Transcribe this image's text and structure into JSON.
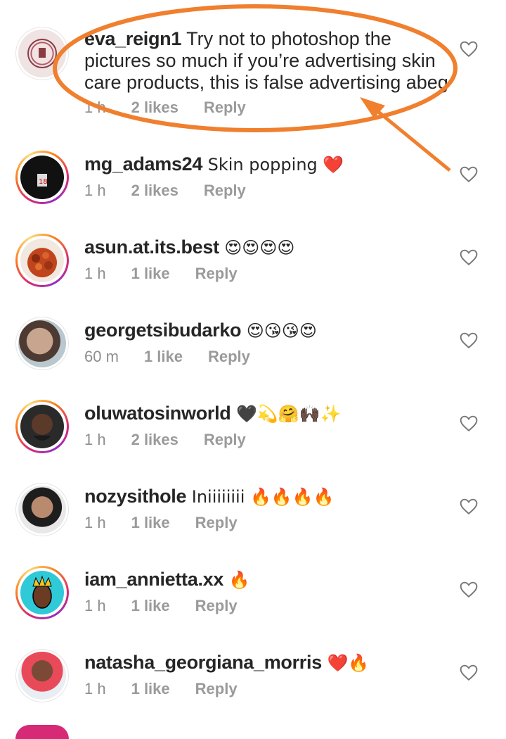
{
  "comments": [
    {
      "username": "eva_reign1",
      "text": "Try not to photoshop the pictures so much if you’re advertising skin care products, this is false advertising abeg",
      "time": "1 h",
      "likes": "2 likes",
      "reply": "Reply"
    },
    {
      "username": "mg_adams24",
      "text": "Skin popping ❤️",
      "time": "1 h",
      "likes": "2 likes",
      "reply": "Reply"
    },
    {
      "username": "asun.at.its.best",
      "text": "😍😍😍😍",
      "time": "1 h",
      "likes": "1 like",
      "reply": "Reply"
    },
    {
      "username": "georgetsibudarko",
      "text": "😍😘😘😍",
      "time": "60 m",
      "likes": "1 like",
      "reply": "Reply"
    },
    {
      "username": "oluwatosinworld",
      "text": "🖤💫🤗🙌🏿✨",
      "time": "1 h",
      "likes": "2 likes",
      "reply": "Reply"
    },
    {
      "username": "nozysithole",
      "text": "Iniiiiiiii 🔥🔥🔥🔥",
      "time": "1 h",
      "likes": "1 like",
      "reply": "Reply"
    },
    {
      "username": "iam_annietta.xx",
      "text": "🔥",
      "time": "1 h",
      "likes": "1 like",
      "reply": "Reply"
    },
    {
      "username": "natasha_georgiana_morris",
      "text": "❤️🔥",
      "time": "1 h",
      "likes": "1 like",
      "reply": "Reply"
    }
  ],
  "colors": {
    "annotation": "#f07f2e",
    "muted": "#8e8e8e",
    "story_ring": "#d62976"
  },
  "icons": {
    "like": "heart-outline-icon"
  }
}
